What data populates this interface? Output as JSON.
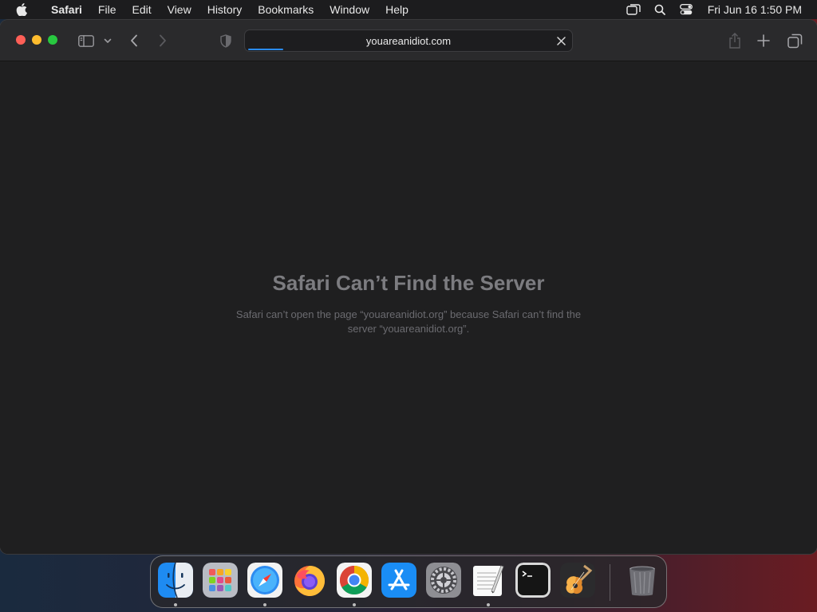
{
  "menubar": {
    "app_name": "Safari",
    "items": [
      "File",
      "Edit",
      "View",
      "History",
      "Bookmarks",
      "Window",
      "Help"
    ],
    "clock": "Fri Jun 16  1:50 PM"
  },
  "toolbar": {
    "address": "youareanidiot.com"
  },
  "error": {
    "title": "Safari Can’t Find the Server",
    "message": "Safari can’t open the page “youareanidiot.org” because Safari can’t find the server “youareanidiot.org”."
  },
  "dock": {
    "apps": [
      "Finder",
      "Launchpad",
      "Safari",
      "Firefox",
      "Google Chrome",
      "App Store",
      "System Settings",
      "TextEdit",
      "Terminal",
      "GarageBand"
    ],
    "trash": "Trash"
  },
  "colors": {
    "close": "#fe5f57",
    "minimize": "#febc2e",
    "maximize": "#28c840",
    "accent": "#2a8cf5"
  }
}
